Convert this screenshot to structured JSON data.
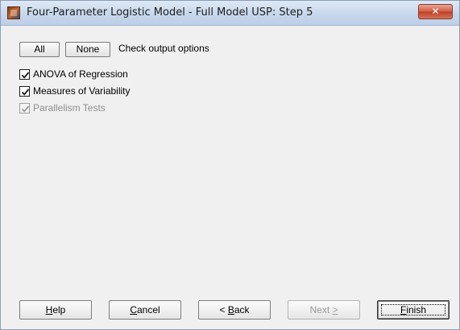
{
  "window": {
    "title": "Four-Parameter Logistic Model - Full Model USP: Step 5",
    "close_symbol": "✕",
    "icon": "app-icon"
  },
  "toolbar": {
    "all_label": "All",
    "none_label": "None",
    "description": "Check output options"
  },
  "options": [
    {
      "label": "ANOVA of Regression",
      "checked": true,
      "enabled": true
    },
    {
      "label": "Measures of Variability",
      "checked": true,
      "enabled": true
    },
    {
      "label": "Parallelism Tests",
      "checked": true,
      "enabled": false
    }
  ],
  "buttons": {
    "help": {
      "mnemonic": "H",
      "rest": "elp"
    },
    "cancel": {
      "mnemonic": "C",
      "rest": "ancel"
    },
    "back": {
      "lead": "< ",
      "mnemonic": "B",
      "rest": "ack"
    },
    "next": {
      "lead": "Next ",
      "mnemonic": ">",
      "rest": ""
    },
    "finish": {
      "mnemonic": "F",
      "rest": "inish"
    }
  }
}
